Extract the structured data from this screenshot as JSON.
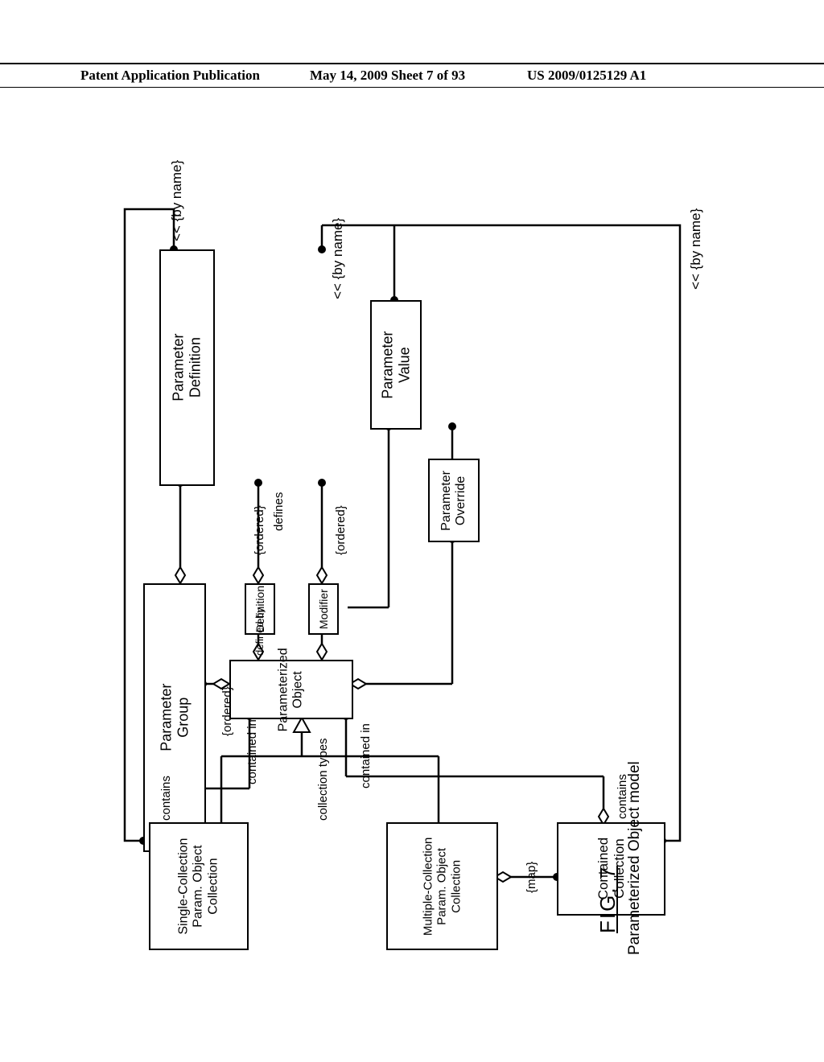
{
  "header": {
    "left": "Patent Application Publication",
    "center": "May 14, 2009  Sheet 7 of 93",
    "right": "US 2009/0125129 A1"
  },
  "boxes": {
    "param_def_l1": "Parameter",
    "param_def_l2": "Definition",
    "param_val_l1": "Parameter",
    "param_val_l2": "Value",
    "param_ovr_l1": "Parameter",
    "param_ovr_l2": "Override",
    "param_grp_l1": "Parameter",
    "param_grp_l2": "Group",
    "definition": "Definition",
    "modifier": "Modifier",
    "param_obj_l1": "Parameterized",
    "param_obj_l2": "Object",
    "single_l1": "Single-Collection",
    "single_l2": "Param. Object",
    "single_l3": "Collection",
    "multi_l1": "Multiple-Collection",
    "multi_l2": "Param. Object",
    "multi_l3": "Collection",
    "contained_l1": "Contained",
    "contained_l2": "Collection"
  },
  "labels": {
    "byname1": "<< {by name}",
    "byname2": "<< {by name}",
    "byname3": "<< {by name}",
    "ordered1": "{ordered}",
    "ordered2": "{ordered}",
    "ordered3": "{ordered}",
    "defines": "defines",
    "defined_by": "defined by",
    "contained_in1": "contained in",
    "contained_in2": "contained in",
    "collection_types": "collection types",
    "contains1": "contains",
    "contains2": "contains",
    "map": "{map}"
  },
  "caption": {
    "fig": "FIG. 7",
    "title": "Parameterized Object model"
  }
}
